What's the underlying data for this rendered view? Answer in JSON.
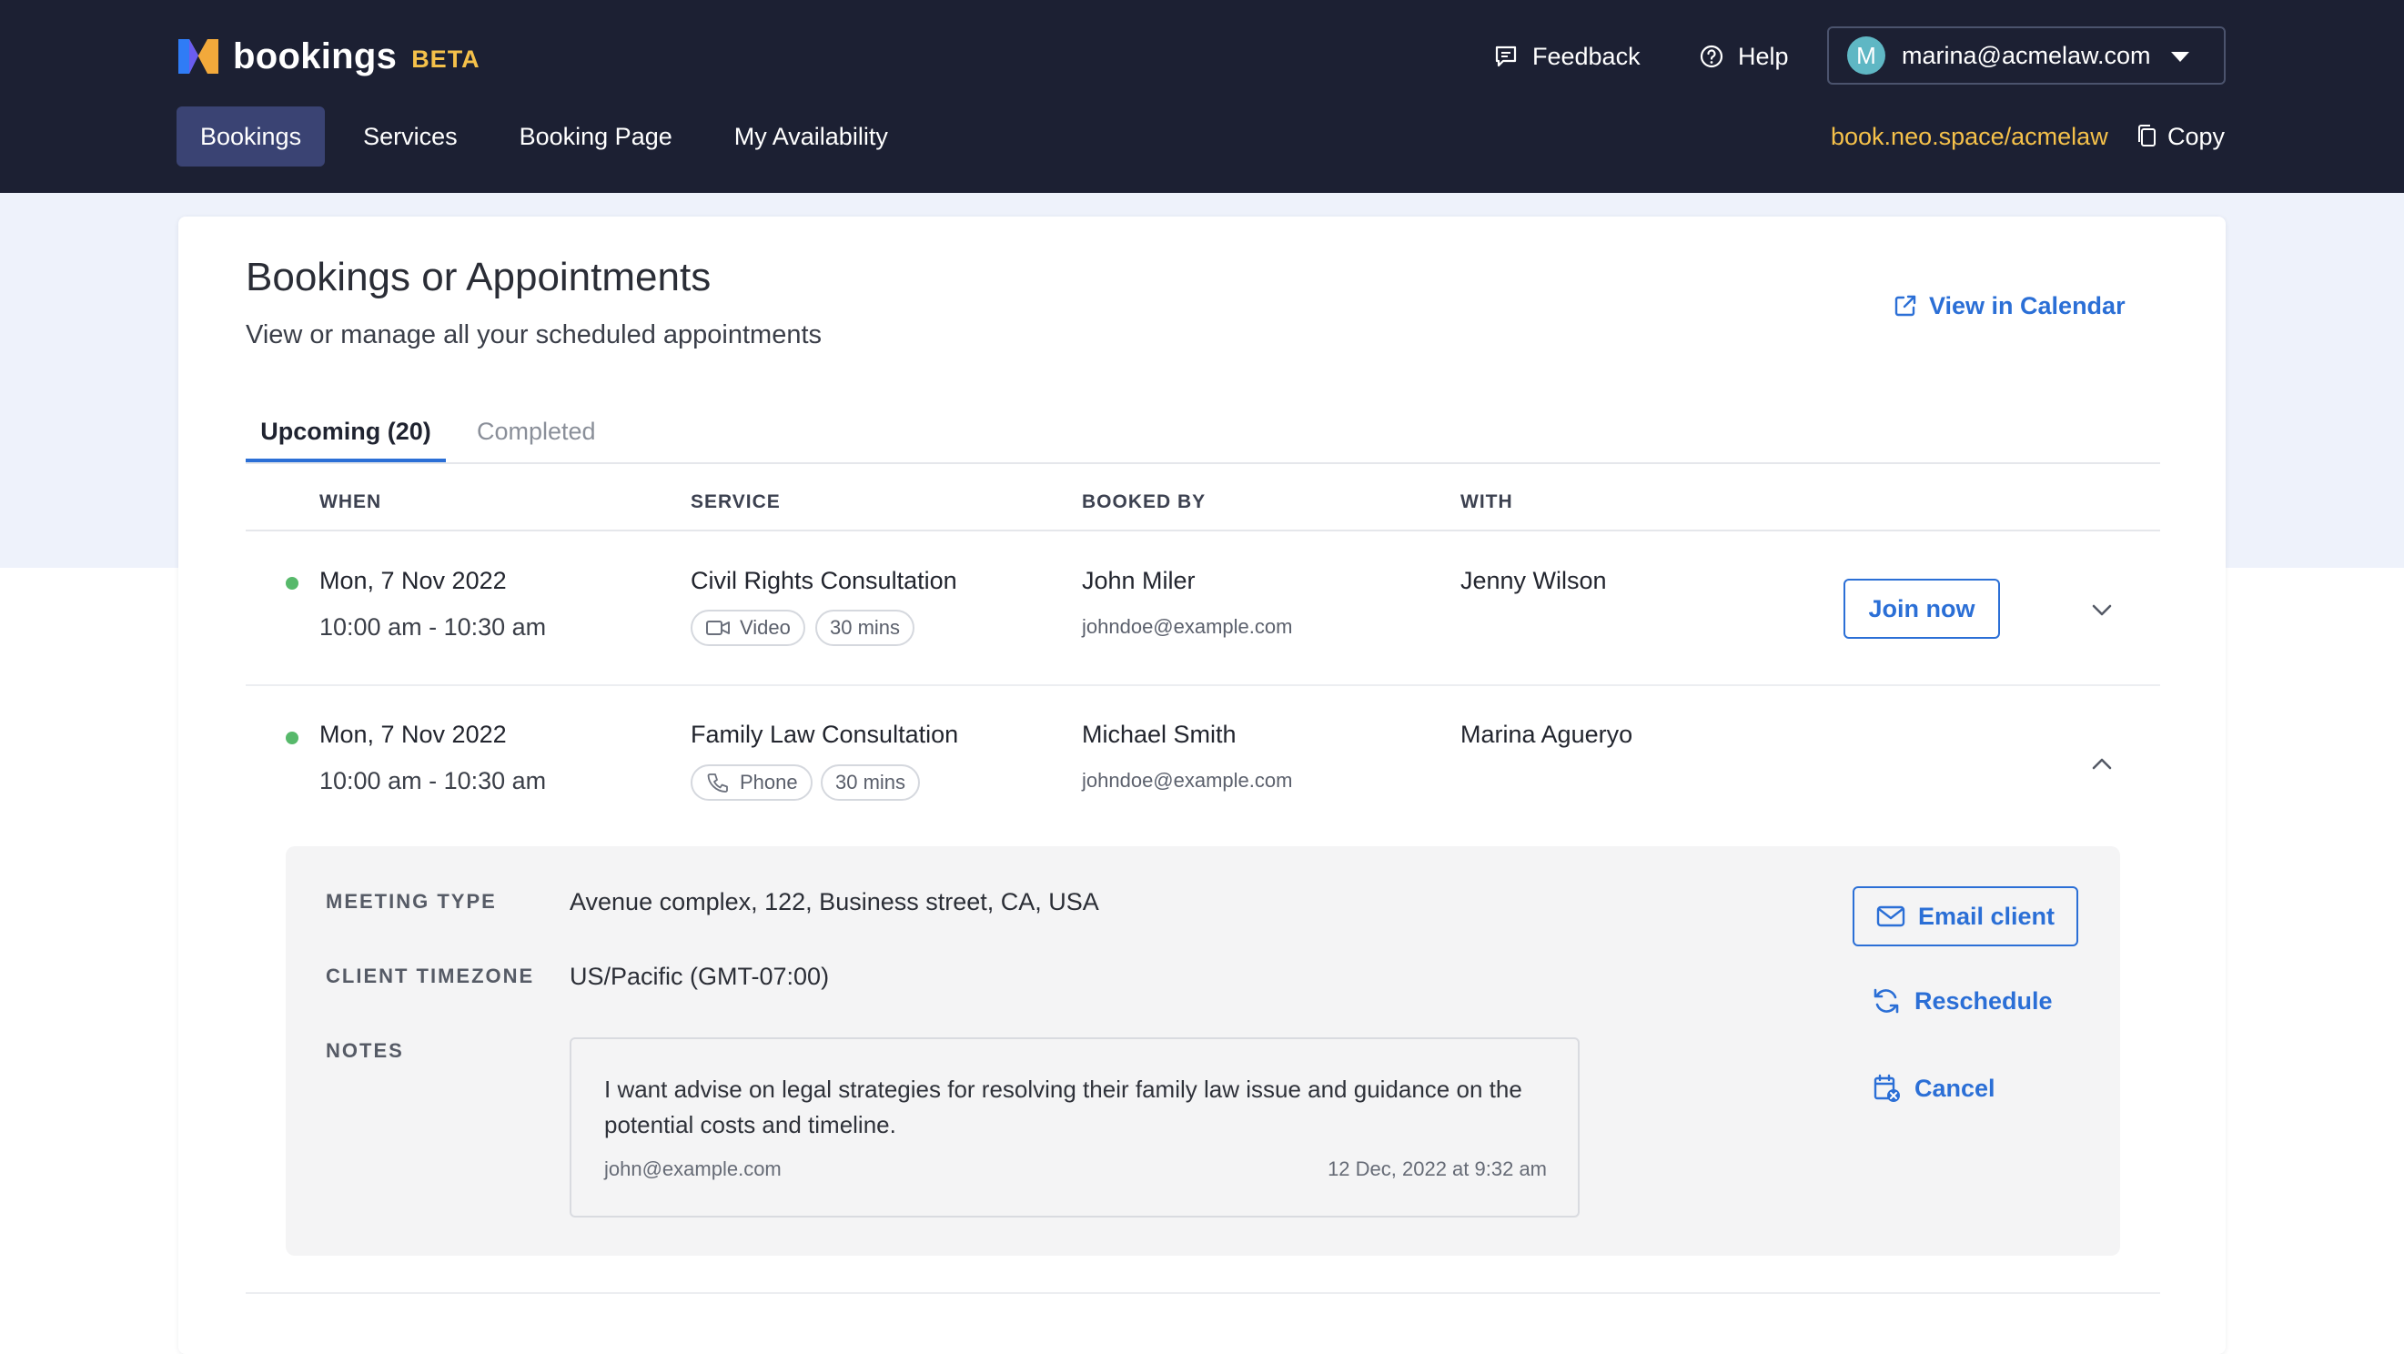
{
  "brand": {
    "name": "bookings",
    "badge": "BETA"
  },
  "header": {
    "feedback_label": "Feedback",
    "help_label": "Help",
    "user_initial": "M",
    "user_email": "marina@acmelaw.com",
    "nav": [
      {
        "label": "Bookings",
        "active": true
      },
      {
        "label": "Services"
      },
      {
        "label": "Booking Page"
      },
      {
        "label": "My Availability"
      }
    ],
    "booking_link": "book.neo.space/acmelaw",
    "copy_label": "Copy"
  },
  "page": {
    "title": "Bookings or Appointments",
    "subtitle": "View or manage all your scheduled appointments",
    "view_calendar_label": "View in Calendar"
  },
  "tabs": [
    {
      "label": "Upcoming (20)",
      "active": true
    },
    {
      "label": "Completed"
    }
  ],
  "table": {
    "headers": [
      "WHEN",
      "SERVICE",
      "BOOKED BY",
      "WITH"
    ],
    "rows": [
      {
        "date": "Mon, 7 Nov 2022",
        "time": "10:00 am - 10:30 am",
        "service": "Civil Rights Consultation",
        "mode": "Video",
        "mode_icon": "video-icon",
        "duration": "30 mins",
        "booked_by": "John Miler",
        "booked_email": "johndoe@example.com",
        "with": "Jenny Wilson",
        "action_label": "Join now",
        "expanded": false
      },
      {
        "date": "Mon, 7 Nov 2022",
        "time": "10:00 am - 10:30 am",
        "service": "Family Law Consultation",
        "mode": "Phone",
        "mode_icon": "phone-icon",
        "duration": "30 mins",
        "booked_by": "Michael Smith",
        "booked_email": "johndoe@example.com",
        "with": "Marina Agueryo",
        "expanded": true
      }
    ]
  },
  "details": {
    "meeting_type_label": "MEETING TYPE",
    "meeting_type_value": "Avenue complex, 122, Business street, CA, USA",
    "timezone_label": "CLIENT TIMEZONE",
    "timezone_value": "US/Pacific (GMT-07:00)",
    "notes_label": "NOTES",
    "notes_text": "I want advise on legal strategies for resolving their family law issue and guidance on the potential costs and timeline.",
    "notes_author": "john@example.com",
    "notes_date": "12 Dec, 2022 at 9:32 am",
    "email_client_label": "Email client",
    "reschedule_label": "Reschedule",
    "cancel_label": "Cancel"
  },
  "colors": {
    "header_bg": "#1c2033",
    "nav_active_bg": "#3a4373",
    "accent_yellow": "#f5c14a",
    "link_blue": "#2b6fd6",
    "status_green": "#57b96b",
    "avatar_bg": "#5fb7c4"
  }
}
